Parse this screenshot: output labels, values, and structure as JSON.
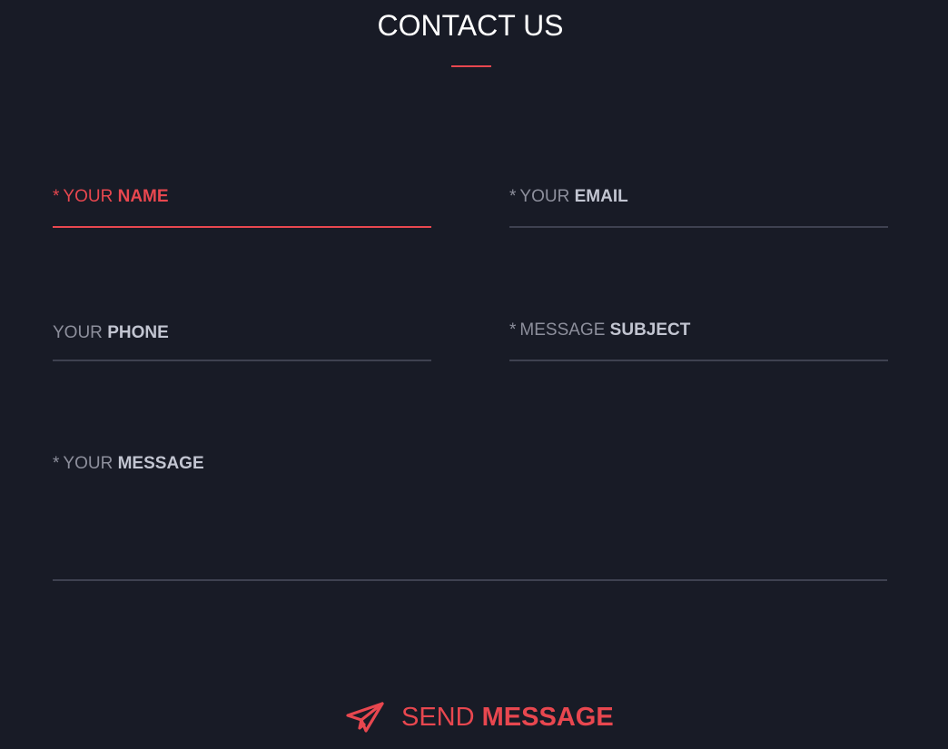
{
  "header": {
    "title": "CONTACT US"
  },
  "form": {
    "name": {
      "required_mark": "*",
      "prefix": "YOUR",
      "strong": "NAME",
      "value": ""
    },
    "email": {
      "required_mark": "*",
      "prefix": "YOUR",
      "strong": "EMAIL",
      "value": ""
    },
    "phone": {
      "prefix": "YOUR",
      "strong": "PHONE",
      "value": ""
    },
    "subject": {
      "required_mark": "*",
      "prefix": "MESSAGE",
      "strong": "SUBJECT",
      "value": ""
    },
    "message": {
      "required_mark": "*",
      "prefix": "YOUR",
      "strong": "MESSAGE",
      "value": ""
    }
  },
  "send_button": {
    "prefix": "SEND",
    "strong": "MESSAGE",
    "icon": "paper-plane-icon"
  },
  "colors": {
    "background": "#181b26",
    "accent": "#e8474f",
    "label": "#8d8f9c",
    "label_strong": "#c2c5d1",
    "line": "#3e4150"
  }
}
